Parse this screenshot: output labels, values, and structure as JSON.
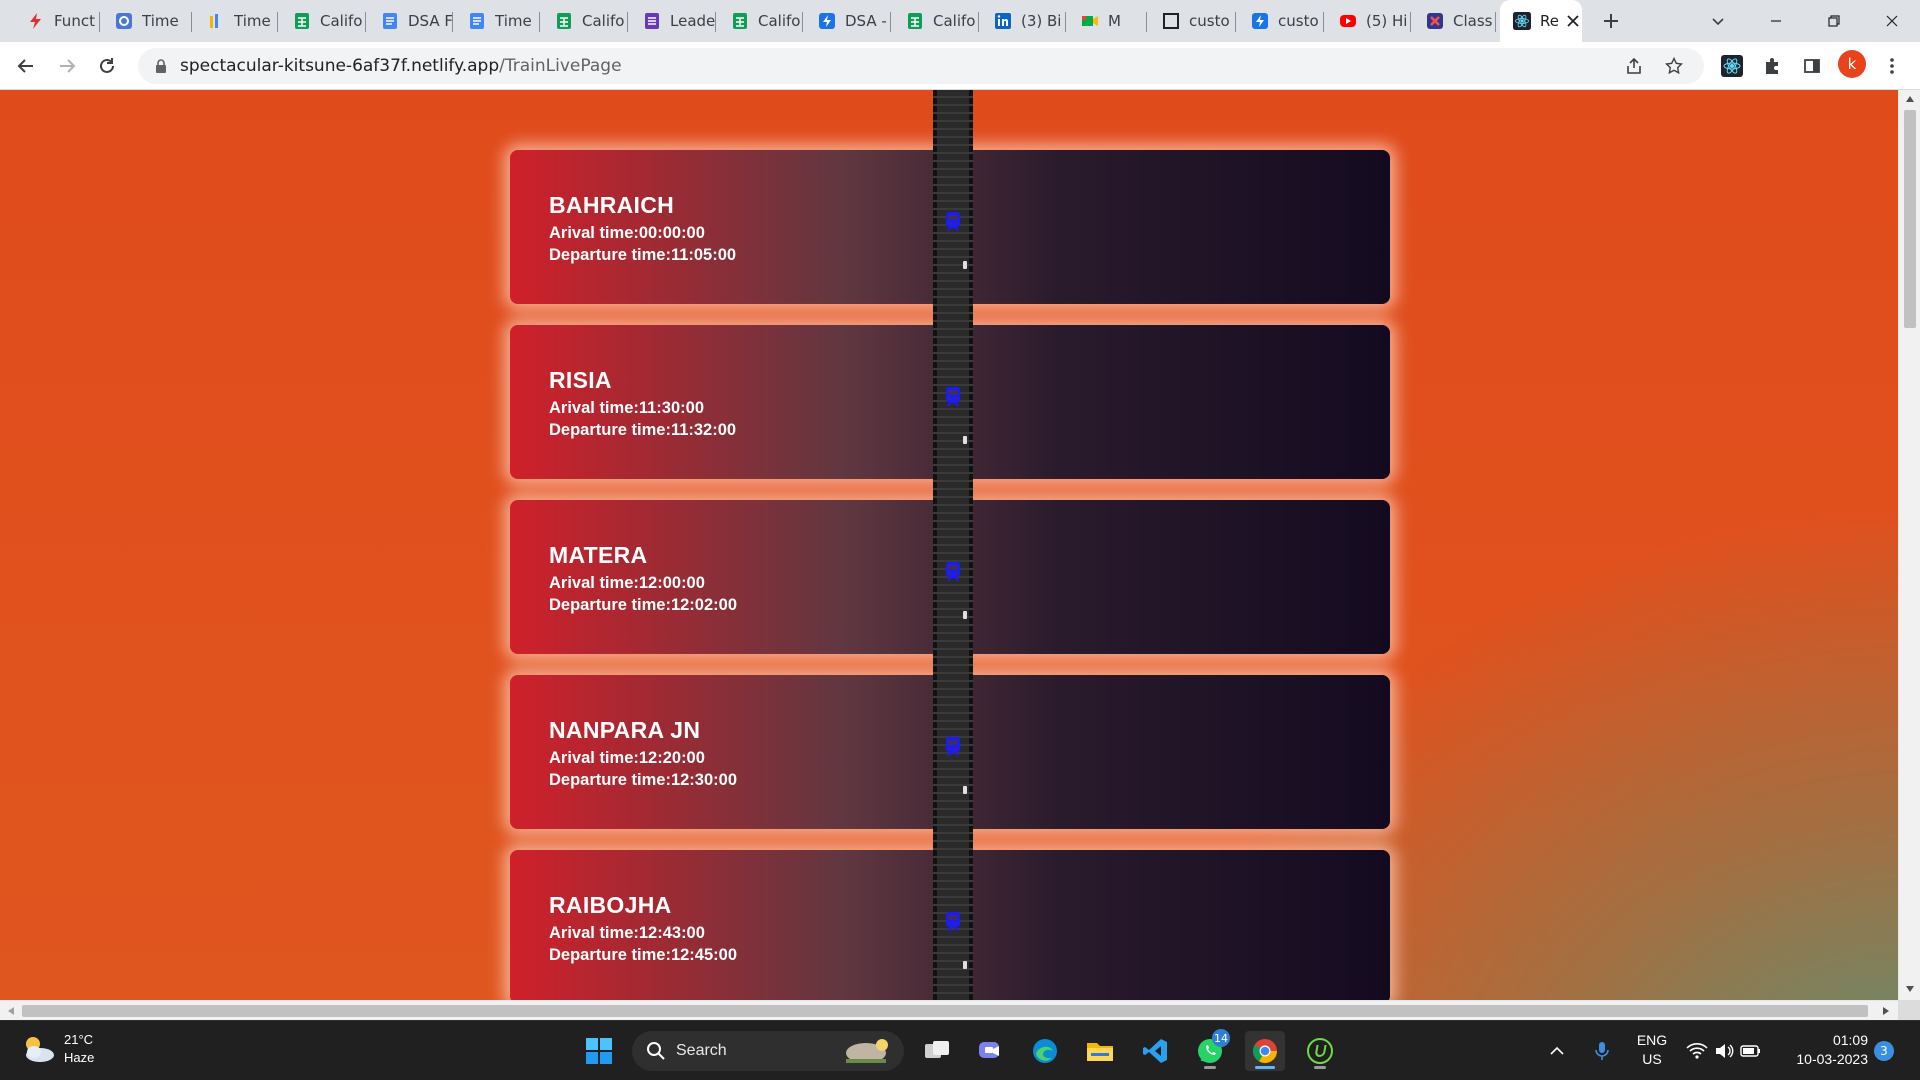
{
  "browser": {
    "tabs": [
      {
        "title": "Funct",
        "icon": "red-bolt-icon"
      },
      {
        "title": "Time",
        "icon": "gear-badge-icon"
      },
      {
        "title": "Time",
        "icon": "bar-chart-icon"
      },
      {
        "title": "Califo",
        "icon": "sheets-icon"
      },
      {
        "title": "DSA F",
        "icon": "docs-icon"
      },
      {
        "title": "Time",
        "icon": "docs-icon"
      },
      {
        "title": "Califo",
        "icon": "sheets-icon"
      },
      {
        "title": "Leade",
        "icon": "forms-icon"
      },
      {
        "title": "Califo",
        "icon": "sheets-icon"
      },
      {
        "title": "DSA -",
        "icon": "blue-bolt-icon"
      },
      {
        "title": "Califo",
        "icon": "sheets-icon"
      },
      {
        "title": "(3) Bi",
        "icon": "linkedin-icon"
      },
      {
        "title": "M",
        "icon": "meet-icon"
      },
      {
        "title": "custo",
        "icon": "square-outline-icon"
      },
      {
        "title": "custo",
        "icon": "blue-bolt-icon"
      },
      {
        "title": "(5) Hi",
        "icon": "youtube-icon"
      },
      {
        "title": "Class",
        "icon": "class-icon"
      },
      {
        "title": "Re",
        "icon": "react-icon"
      }
    ],
    "url_host": "spectacular-kitsune-6af37f.netlify.app",
    "url_path": "/TrainLivePage",
    "profile_initial": "k"
  },
  "stations": [
    {
      "name": "BAHRAICH",
      "arrival": "Arival time:00:00:00",
      "departure": "Departure time:11:05:00"
    },
    {
      "name": "RISIA",
      "arrival": "Arival time:11:30:00",
      "departure": "Departure time:11:32:00"
    },
    {
      "name": "MATERA",
      "arrival": "Arival time:12:00:00",
      "departure": "Departure time:12:02:00"
    },
    {
      "name": "NANPARA JN",
      "arrival": "Arival time:12:20:00",
      "departure": "Departure time:12:30:00"
    },
    {
      "name": "RAIBOJHA",
      "arrival": "Arival time:12:43:00",
      "departure": "Departure time:12:45:00"
    }
  ],
  "taskbar": {
    "weather_temp": "21°C",
    "weather_desc": "Haze",
    "search_label": "Search",
    "whatsapp_badge": "14",
    "lang_top": "ENG",
    "lang_bottom": "US",
    "time": "01:09",
    "date": "10-03-2023",
    "notification_count": "3"
  },
  "colors": {
    "page_orange": "#e04b1c",
    "card_red": "#d0202a",
    "card_dark": "#140a20",
    "train_marker": "#1a1aff"
  }
}
